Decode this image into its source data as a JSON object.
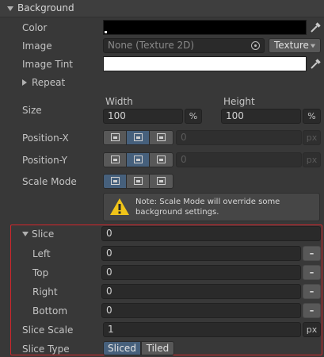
{
  "section": {
    "title": "Background"
  },
  "color": {
    "label": "Color",
    "value_hex": "#000000"
  },
  "image": {
    "label": "Image",
    "value": "None (Texture 2D)",
    "type_label": "Texture"
  },
  "image_tint": {
    "label": "Image Tint",
    "value_hex": "#ffffff"
  },
  "repeat": {
    "label": "Repeat"
  },
  "size": {
    "label": "Size",
    "width_label": "Width",
    "width_value": "100",
    "width_unit": "%",
    "height_label": "Height",
    "height_value": "100",
    "height_unit": "%"
  },
  "position_x": {
    "label": "Position-X",
    "value": "0",
    "unit": "px",
    "selected_index": 1
  },
  "position_y": {
    "label": "Position-Y",
    "value": "0",
    "unit": "px",
    "selected_index": 1
  },
  "scale_mode": {
    "label": "Scale Mode",
    "selected_index": 0,
    "note": "Note: Scale Mode will override some background settings."
  },
  "slice": {
    "label": "Slice",
    "value": "0",
    "left_label": "Left",
    "left_value": "0",
    "top_label": "Top",
    "top_value": "0",
    "right_label": "Right",
    "right_value": "0",
    "bottom_label": "Bottom",
    "bottom_value": "0",
    "dash": "–"
  },
  "slice_scale": {
    "label": "Slice Scale",
    "value": "1",
    "unit": "px"
  },
  "slice_type": {
    "label": "Slice Type",
    "options": [
      "Sliced",
      "Tiled"
    ],
    "selected": "Sliced"
  },
  "colors": {
    "accent": "#46607c",
    "highlight": "#d3262b",
    "warning": "#f0c419"
  }
}
